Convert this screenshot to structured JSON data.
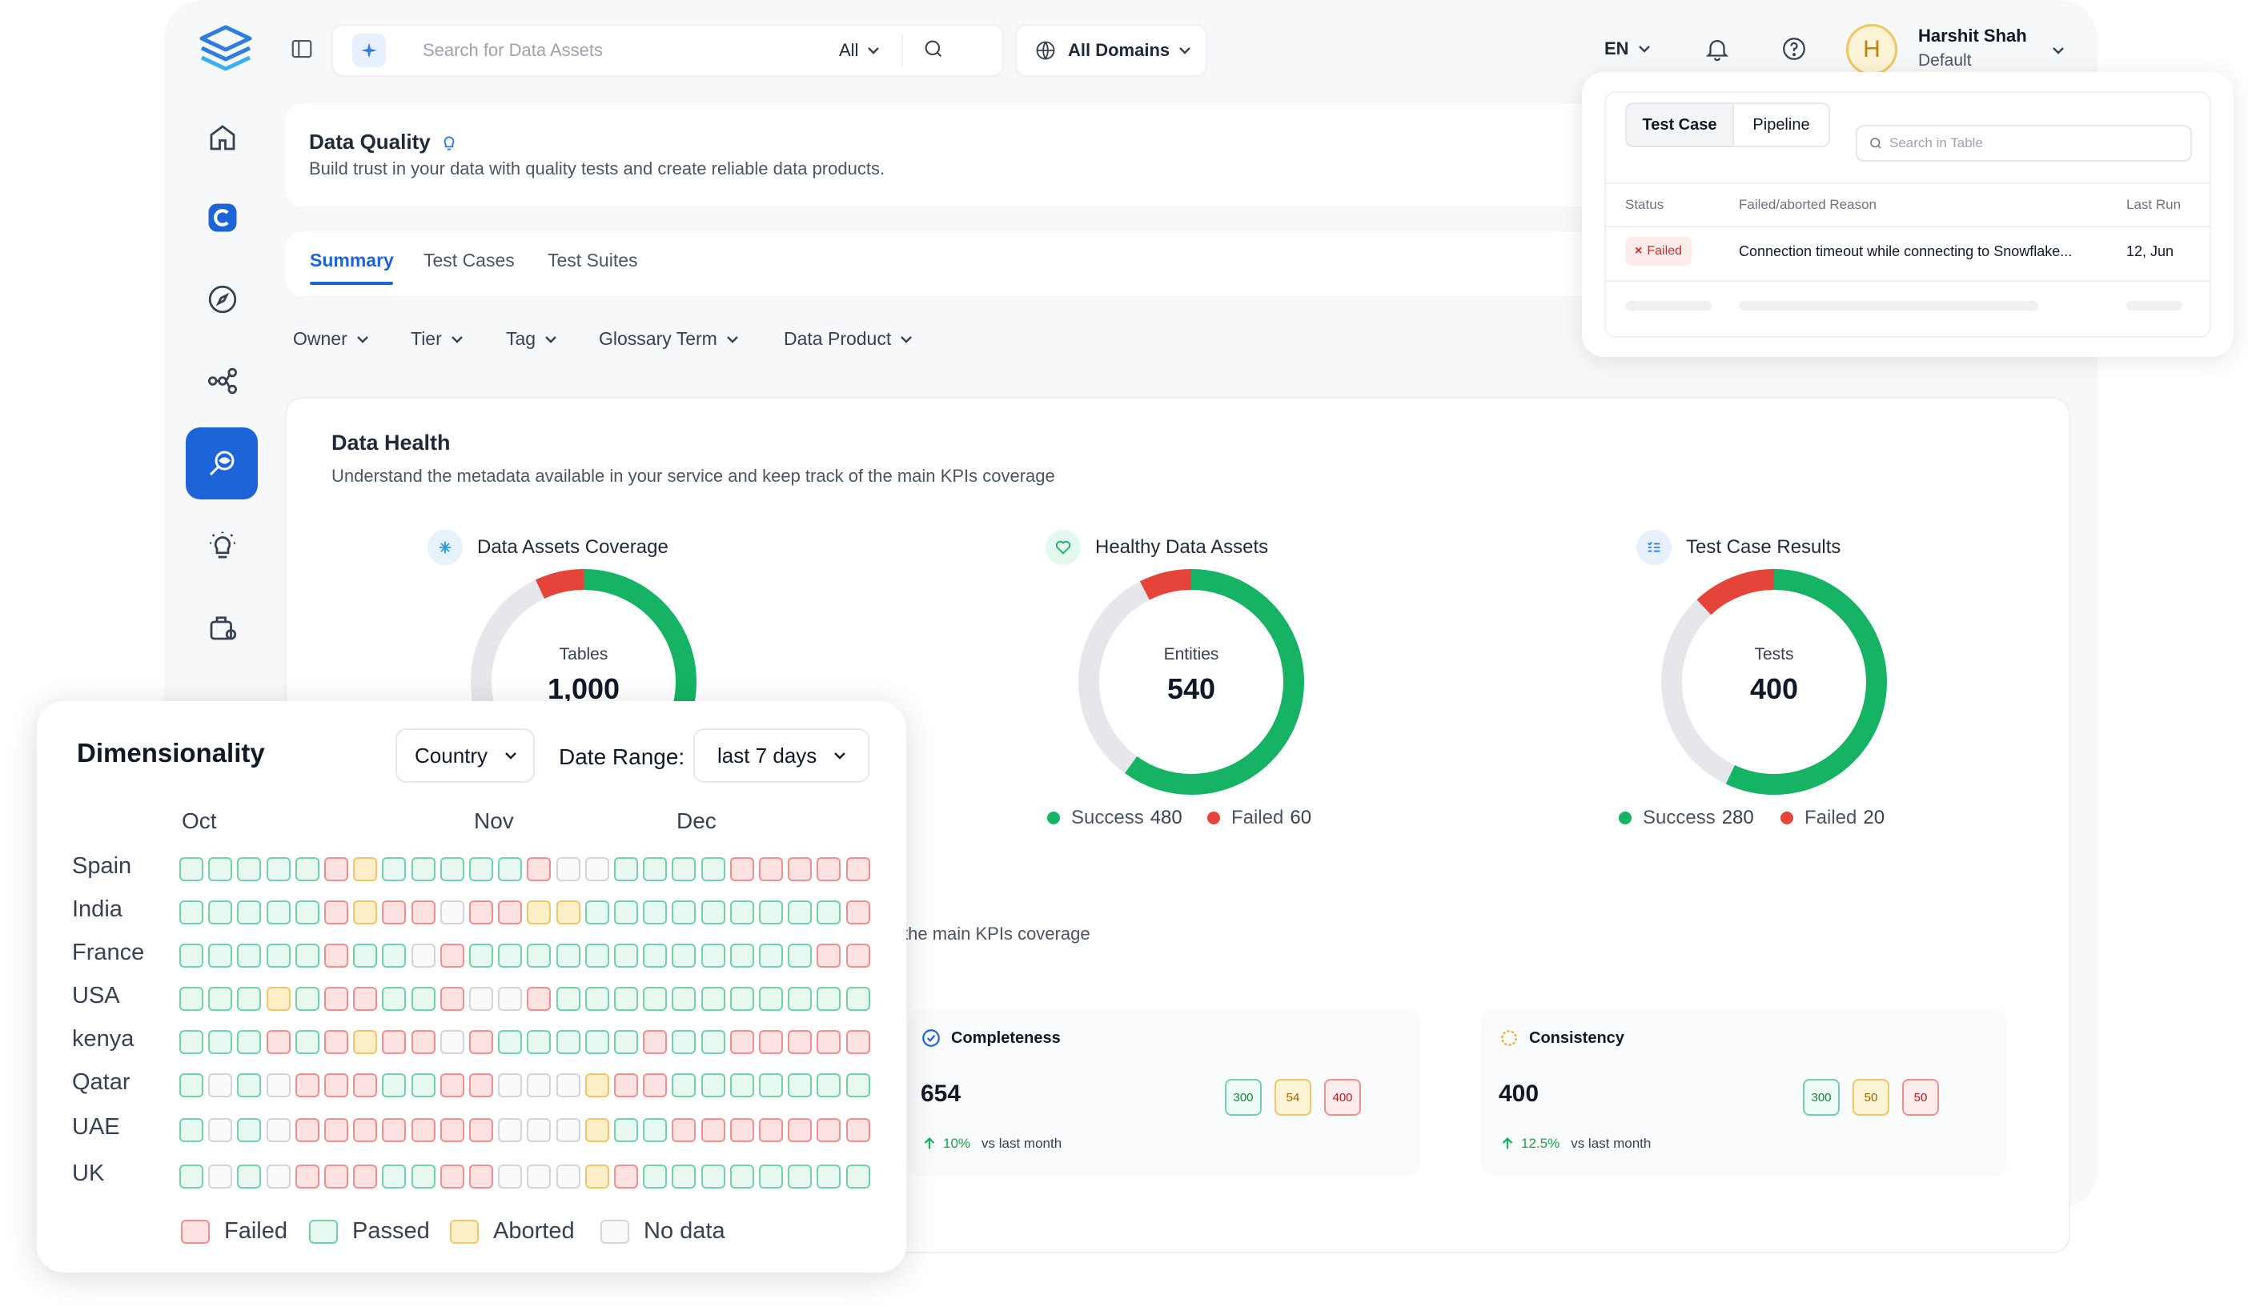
{
  "topbar": {
    "search_placeholder": "Search for Data Assets",
    "search_scope": "All",
    "domains": "All Domains",
    "language": "EN",
    "user_initial": "H",
    "user_name": "Harshit Shah",
    "user_role": "Default"
  },
  "header": {
    "title": "Data Quality",
    "subtitle": "Build trust in your data with quality tests and create reliable data products."
  },
  "tabs": [
    {
      "label": "Summary",
      "active": true
    },
    {
      "label": "Test Cases",
      "active": false
    },
    {
      "label": "Test Suites",
      "active": false
    }
  ],
  "filters": [
    "Owner",
    "Tier",
    "Tag",
    "Glossary Term",
    "Data Product"
  ],
  "data_health": {
    "title": "Data Health",
    "subtitle": "Understand the metadata available in your service and keep track of the main KPIs coverage",
    "kpis": [
      {
        "title": "Data Assets Coverage",
        "center_label": "Tables",
        "center_value": "1,000",
        "success_fraction": 0.45,
        "failed_fraction": 0.07
      },
      {
        "title": "Healthy Data Assets",
        "center_label": "Entities",
        "center_value": "540",
        "success_label": "Success",
        "success_value": "480",
        "failed_label": "Failed",
        "failed_value": "60",
        "success_fraction": 0.6,
        "failed_fraction": 0.075
      },
      {
        "title": "Test Case Results",
        "center_label": "Tests",
        "center_value": "400",
        "success_label": "Success",
        "success_value": "280",
        "failed_label": "Failed",
        "failed_value": "20",
        "success_fraction": 0.57,
        "failed_fraction": 0.12
      }
    ]
  },
  "second_section": {
    "subtitle_fragment": "the main KPIs coverage",
    "cards": [
      {
        "title": "Completeness",
        "value": "654",
        "change": "10%",
        "change_text": "vs last month",
        "badges": [
          "300",
          "54",
          "400"
        ]
      },
      {
        "title": "Consistency",
        "value": "400",
        "change": "12.5%",
        "change_text": "vs last month",
        "badges": [
          "300",
          "50",
          "50"
        ]
      }
    ]
  },
  "popup": {
    "tabs": [
      "Test Case",
      "Pipeline"
    ],
    "search_placeholder": "Search in Table",
    "columns": [
      "Status",
      "Failed/aborted Reason",
      "Last Run"
    ],
    "rows": [
      {
        "status": "Failed",
        "reason": "Connection timeout while connecting to Snowflake...",
        "last_run": "12, Jun"
      }
    ]
  },
  "dimensionality": {
    "title": "Dimensionality",
    "group_by": "Country",
    "date_range_label": "Date Range:",
    "date_range": "last 7 days",
    "months": [
      "Oct",
      "Nov",
      "Dec"
    ],
    "legend": [
      "Failed",
      "Passed",
      "Aborted",
      "No data"
    ],
    "status_key": {
      "F": "failed",
      "P": "passed",
      "A": "aborted",
      "N": "nodata"
    },
    "rows": [
      {
        "country": "Spain",
        "cells": "PPPPPFAPPPPPFNNPPPPFFFFF"
      },
      {
        "country": "India",
        "cells": "PPPPPFAFFNFFAAPPPPPPPPPF"
      },
      {
        "country": "France",
        "cells": "PPPPPFPPNFPPPPPPPPPPPPFF"
      },
      {
        "country": "USA",
        "cells": "PPPAPFFPPFNNFPPPPPPPPPPP"
      },
      {
        "country": "kenya",
        "cells": "PPPFPFAFFNFPPPPPFPPFFFFF"
      },
      {
        "country": "Qatar",
        "cells": "PNPNFFFPPFFNNNAFFPPPPPPP"
      },
      {
        "country": "UAE",
        "cells": "PNPNFFFFFFFNNNAPPFFFFFFF"
      },
      {
        "country": "UK",
        "cells": "PNPNFFFPPFFNNNAFPPPPPPPP"
      }
    ]
  },
  "colors": {
    "success": "#16b364",
    "failed": "#e5443b",
    "track": "#e5e7eb",
    "accent": "#1d64d8"
  }
}
